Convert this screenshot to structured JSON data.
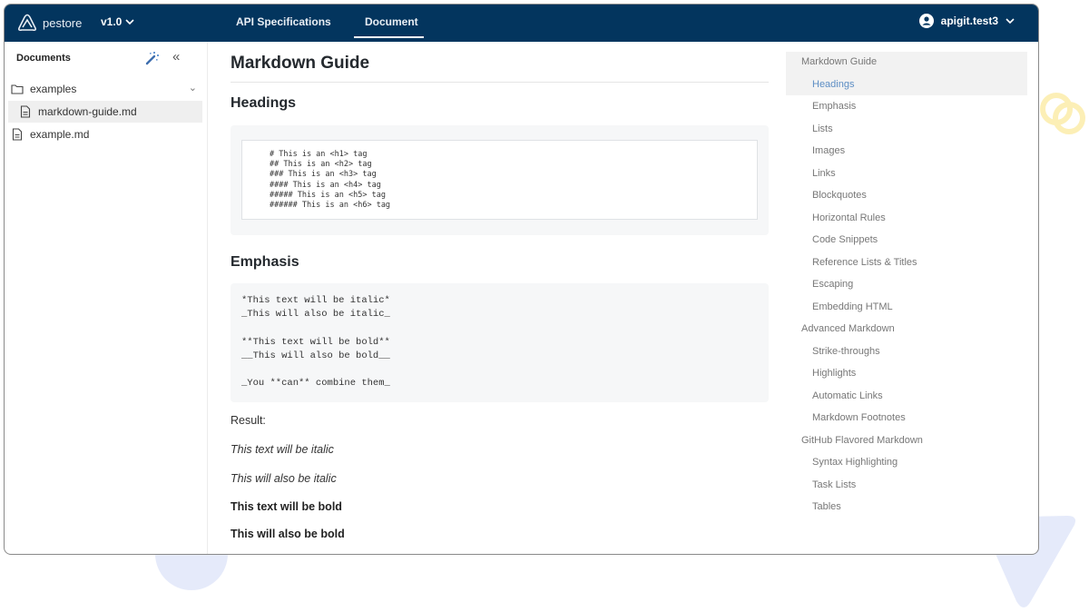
{
  "header": {
    "brand": "pestore",
    "version": "v1.0",
    "tabs": [
      {
        "label": "API Specifications",
        "active": false
      },
      {
        "label": "Document",
        "active": true
      }
    ],
    "user": "apigit.test3"
  },
  "sidebar": {
    "title": "Documents",
    "tree": [
      {
        "label": "examples",
        "type": "folder",
        "expanded": true
      },
      {
        "label": "markdown-guide.md",
        "type": "file",
        "selected": true
      },
      {
        "label": "example.md",
        "type": "file",
        "selected": false
      }
    ]
  },
  "content": {
    "title": "Markdown Guide",
    "sections": [
      {
        "heading": "Headings",
        "code": "# This is an <h1> tag\n## This is an <h2> tag\n### This is an <h3> tag\n#### This is an <h4> tag\n##### This is an <h5> tag\n###### This is an <h6> tag"
      },
      {
        "heading": "Emphasis",
        "code": "*This text will be italic*\n_This will also be italic_\n\n**This text will be bold**\n__This will also be bold__\n\n_You **can** combine them_"
      }
    ],
    "result_label": "Result:",
    "results": [
      "This text will be italic",
      "This will also be italic",
      "This text will be bold",
      "This will also be bold"
    ]
  },
  "toc": {
    "items": [
      {
        "label": "Markdown Guide",
        "level": 1
      },
      {
        "label": "Headings",
        "level": 2,
        "active": true
      },
      {
        "label": "Emphasis",
        "level": 2
      },
      {
        "label": "Lists",
        "level": 2
      },
      {
        "label": "Images",
        "level": 2
      },
      {
        "label": "Links",
        "level": 2
      },
      {
        "label": "Blockquotes",
        "level": 2
      },
      {
        "label": "Horizontal Rules",
        "level": 2
      },
      {
        "label": "Code Snippets",
        "level": 2
      },
      {
        "label": "Reference Lists & Titles",
        "level": 2
      },
      {
        "label": "Escaping",
        "level": 2
      },
      {
        "label": "Embedding HTML",
        "level": 2
      },
      {
        "label": "Advanced Markdown",
        "level": 1
      },
      {
        "label": "Strike-throughs",
        "level": 2
      },
      {
        "label": "Highlights",
        "level": 2
      },
      {
        "label": "Automatic Links",
        "level": 2
      },
      {
        "label": "Markdown Footnotes",
        "level": 2
      },
      {
        "label": "GitHub Flavored Markdown",
        "level": 1
      },
      {
        "label": "Syntax Highlighting",
        "level": 2
      },
      {
        "label": "Task Lists",
        "level": 2
      },
      {
        "label": "Tables",
        "level": 2
      }
    ]
  },
  "colors": {
    "header_bg": "#03355e",
    "toc_active": "#5d8ec4",
    "code_bg": "#f6f7f8"
  }
}
